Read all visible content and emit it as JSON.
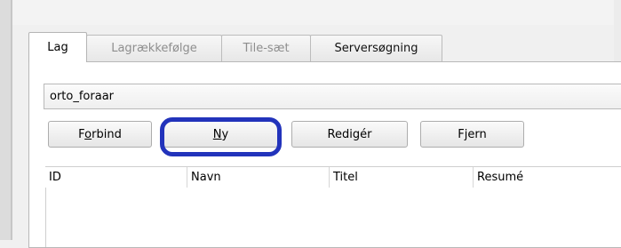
{
  "tabs": [
    {
      "label": "Lag",
      "state": "active"
    },
    {
      "label": "Lagrækkefølge",
      "state": "disabled"
    },
    {
      "label": "Tile-sæt",
      "state": "disabled"
    },
    {
      "label": "Serversøgning",
      "state": "enabled"
    }
  ],
  "connection": {
    "selected": "orto_foraar"
  },
  "buttons": {
    "connect": {
      "before": "F",
      "mnemonic": "o",
      "after": "rbind"
    },
    "new": {
      "before": "",
      "mnemonic": "N",
      "after": "y"
    },
    "edit": {
      "label": "Redigér"
    },
    "remove": {
      "label": "Fjern"
    }
  },
  "table": {
    "columns": [
      "ID",
      "Navn",
      "Titel",
      "Resumé"
    ]
  },
  "colors": {
    "highlight": "#2233bb"
  }
}
